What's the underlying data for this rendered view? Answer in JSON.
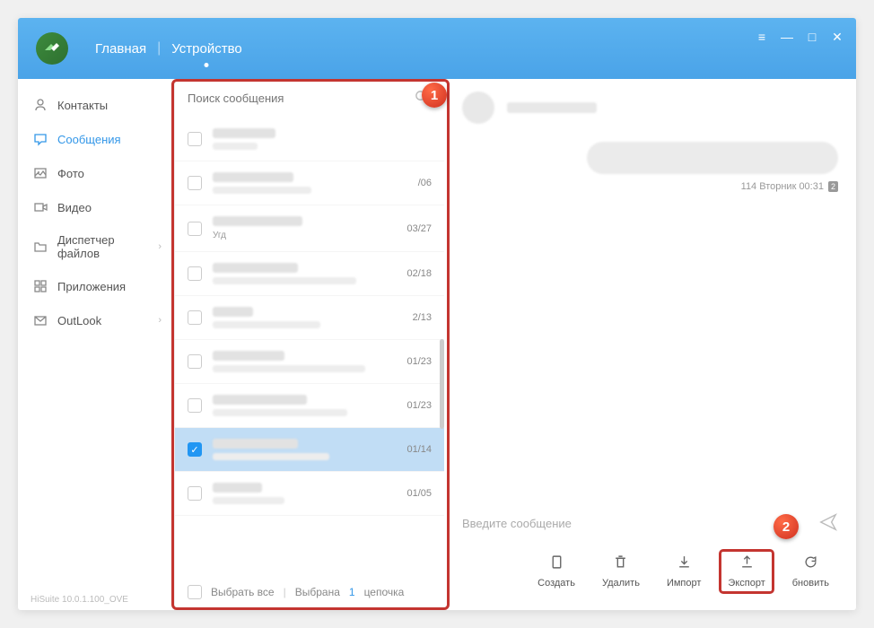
{
  "header": {
    "nav_home": "Главная",
    "nav_device": "Устройство"
  },
  "sidebar": {
    "contacts": "Контакты",
    "messages": "Сообщения",
    "photo": "Фото",
    "video": "Видео",
    "filemanager": "Диспетчер файлов",
    "apps": "Приложения",
    "outlook": "OutLook"
  },
  "search": {
    "placeholder": "Поиск сообщения"
  },
  "messages": [
    {
      "date": "",
      "w1": 70,
      "w2": 50
    },
    {
      "date": "/06",
      "w1": 90,
      "w2": 110
    },
    {
      "date": "03/27",
      "w1": 100,
      "w2": 40,
      "sub_text": "Угд"
    },
    {
      "date": "02/18",
      "w1": 95,
      "w2": 160
    },
    {
      "date": "2/13",
      "w1": 45,
      "w2": 120
    },
    {
      "date": "01/23",
      "w1": 80,
      "w2": 170
    },
    {
      "date": "01/23",
      "w1": 105,
      "w2": 150
    },
    {
      "date": "01/14",
      "w1": 95,
      "w2": 130,
      "selected": true
    },
    {
      "date": "01/05",
      "w1": 55,
      "w2": 80
    }
  ],
  "select_all": {
    "label": "Выбрать все",
    "selected_label": "Выбрана",
    "count": "1",
    "chain": "цепочка"
  },
  "conversation": {
    "timestamp": "114 Вторник 00:31",
    "ts_badge": "2",
    "compose_placeholder": "Введите сообщение"
  },
  "toolbar": {
    "create": "Создать",
    "delete": "Удалить",
    "import": "Импорт",
    "export": "Экспорт",
    "refresh": "бновить"
  },
  "footer": "HiSuite 10.0.1.100_OVE",
  "annotations": {
    "b1": "1",
    "b2": "2"
  }
}
